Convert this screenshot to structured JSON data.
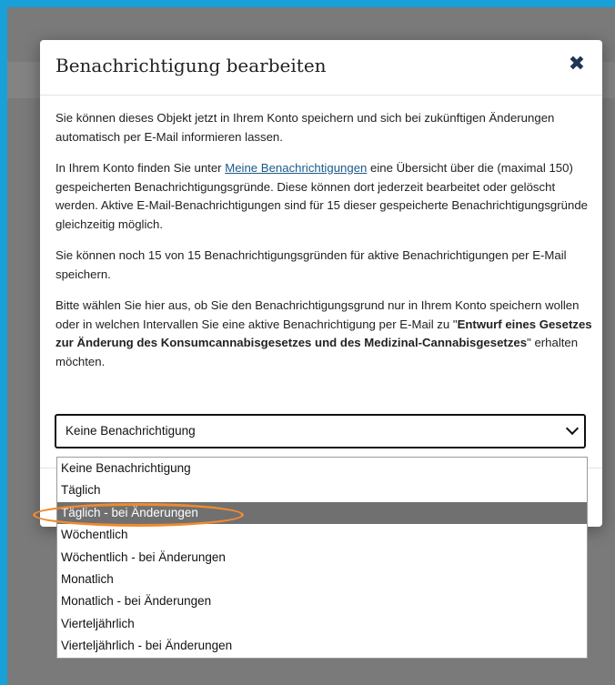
{
  "modal": {
    "title": "Benachrichtigung bearbeiten",
    "close_icon": "close-icon",
    "paragraph1": "Sie können dieses Objekt jetzt in Ihrem Konto speichern und sich bei zukünftigen Änderungen automatisch per E-Mail informieren lassen.",
    "paragraph2_before": "In Ihrem Konto finden Sie unter ",
    "paragraph2_link": "Meine Benachrichtigungen",
    "paragraph2_after": " eine Übersicht über die (maximal 150) gespeicherten Benachrichtigungsgründe. Diese können dort jederzeit bearbeitet oder gelöscht werden. Aktive E-Mail-Benachrichtigungen sind für 15 dieser gespeicherte Benachrichtigungsgründe gleichzeitig möglich.",
    "paragraph3": "Sie können noch 15 von 15 Benachrichtigungsgründen für aktive Benachrichtigungen per E-Mail speichern.",
    "paragraph4_before": "Bitte wählen Sie hier aus, ob Sie den Benachrichtigungsgrund nur in Ihrem Konto speichern wollen oder in welchen Intervallen Sie eine aktive Benachrichtigung per E-Mail zu \"",
    "paragraph4_bold": "Entwurf eines Gesetzes zur Änderung des Konsumcannabisgesetzes und des Medizinal-Cannabisgesetzes",
    "paragraph4_after": "\" erhalten möchten.",
    "select_value": "Keine Benachrichtigung"
  },
  "dropdown": {
    "options": [
      "Keine Benachrichtigung",
      "Täglich",
      "Täglich - bei Änderungen",
      "Wöchentlich",
      "Wöchentlich - bei Änderungen",
      "Monatlich",
      "Monatlich - bei Änderungen",
      "Vierteljährlich",
      "Vierteljährlich - bei Änderungen"
    ],
    "highlighted_index": 2
  },
  "colors": {
    "frame": "#1aa0d8",
    "highlight_ring": "#f08a30",
    "selected_option": "#707070"
  }
}
